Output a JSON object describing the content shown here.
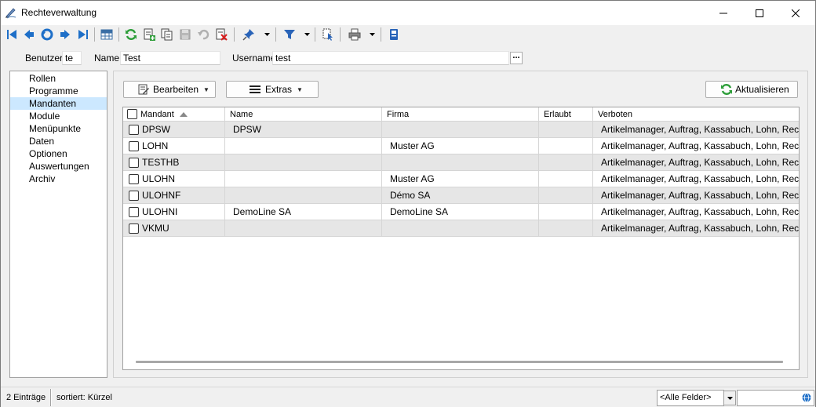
{
  "window": {
    "title": "Rechteverwaltung"
  },
  "filter": {
    "benutzer_label": "Benutzer",
    "benutzer_value": "te",
    "name_label": "Name",
    "name_value": "Test",
    "username_label": "Username",
    "username_value": "test",
    "ellipsis": "..."
  },
  "sidebar": {
    "items": [
      {
        "label": "Rollen"
      },
      {
        "label": "Programme"
      },
      {
        "label": "Mandanten"
      },
      {
        "label": "Module"
      },
      {
        "label": "Menüpunkte"
      },
      {
        "label": "Daten"
      },
      {
        "label": "Optionen"
      },
      {
        "label": "Auswertungen"
      },
      {
        "label": "Archiv"
      }
    ],
    "selected": "Mandanten"
  },
  "buttons": {
    "bearbeiten": "Bearbeiten",
    "extras": "Extras",
    "aktualisieren": "Aktualisieren"
  },
  "grid": {
    "columns": [
      "Mandant",
      "Name",
      "Firma",
      "Erlaubt",
      "Verboten"
    ],
    "rows": [
      {
        "mandant": "DPSW",
        "name": "DPSW",
        "firma": "",
        "erlaubt": "",
        "verboten": "Artikelmanager, Auftrag, Kassabuch, Lohn, Rechn..."
      },
      {
        "mandant": "LOHN",
        "name": "",
        "firma": "Muster AG",
        "erlaubt": "",
        "verboten": "Artikelmanager, Auftrag, Kassabuch, Lohn, Rechn..."
      },
      {
        "mandant": "TESTHB",
        "name": "",
        "firma": "",
        "erlaubt": "",
        "verboten": "Artikelmanager, Auftrag, Kassabuch, Lohn, Rechn..."
      },
      {
        "mandant": "ULOHN",
        "name": "",
        "firma": "Muster AG",
        "erlaubt": "",
        "verboten": "Artikelmanager, Auftrag, Kassabuch, Lohn, Rechn..."
      },
      {
        "mandant": "ULOHNF",
        "name": "",
        "firma": "Démo SA",
        "erlaubt": "",
        "verboten": "Artikelmanager, Auftrag, Kassabuch, Lohn, Rechn..."
      },
      {
        "mandant": "ULOHNI",
        "name": "DemoLine SA",
        "firma": "DemoLine SA",
        "erlaubt": "",
        "verboten": "Artikelmanager, Auftrag, Kassabuch, Lohn, Rechn..."
      },
      {
        "mandant": "VKMU",
        "name": "",
        "firma": "",
        "erlaubt": "",
        "verboten": "Artikelmanager, Auftrag, Kassabuch, Lohn, Rechn..."
      }
    ]
  },
  "status": {
    "count": "2 Einträge",
    "sort": "sortiert: Kürzel",
    "field_combo": "<Alle Felder>"
  },
  "colors": {
    "accent_blue": "#1e6fc8",
    "green": "#2e9e3a",
    "selected_bg": "#cce8ff",
    "alt_row": "#e6e6e6"
  },
  "icons": {
    "toolbar": [
      "first-icon",
      "prev-icon",
      "back-icon",
      "next-icon",
      "last-icon",
      "table-icon",
      "refresh-icon",
      "new-record-icon",
      "copy-icon",
      "save-icon",
      "undo-icon",
      "delete-icon",
      "pin-icon",
      "filter-icon",
      "select-icon",
      "print-icon",
      "info-icon"
    ]
  }
}
